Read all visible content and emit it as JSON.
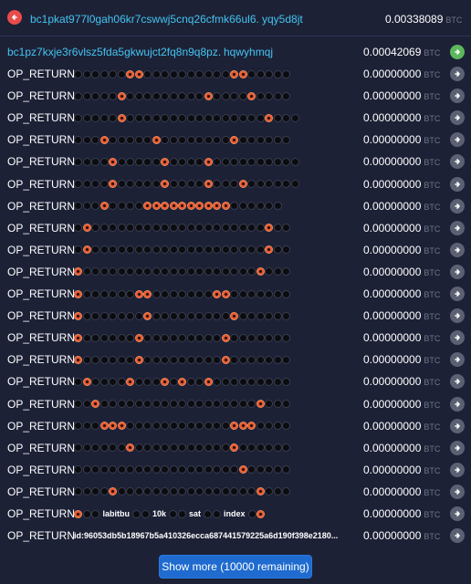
{
  "input": {
    "address_start": "bc1pkat977l0gah06kr7cswwj5cnq26cfmk66ul6...",
    "address_end": "yqy5d8jt",
    "amount": "0.00338089",
    "unit": "BTC"
  },
  "first_output": {
    "address_start": "bc1pz7kxje3r6vlsz5fda5gkwujct2fq8n9q8pz...",
    "address_end": "hqwyhmqj",
    "amount": "0.00042069",
    "unit": "BTC"
  },
  "op_return_label": "OP_RETURN",
  "zero_amount": "0.00000000",
  "unit": "BTC",
  "payload_rows": [
    "bbbbbbrrbbbbbbbbbbrrbbbbb",
    "bbbbbrbbbbbbbbbrbbbbrbbbb",
    "bbbbbrbbbbbbbbbbbbbbbbrbbb",
    "bbbrbbbbbrbbbbbbbbrbbbbbb",
    "bbbbrbbbbbrbbbbrbbbbbbbbbb",
    "bbbbrbbbbbrbbbbrbbbrbbbbbb",
    "bbbrbbbbrrrrrrrrrrbbbbbb",
    "brbbbbbbbbbbbbbbbbbbbbrbb",
    "brbbbbbbbbbbbbbbbbbbbbrbb",
    "rbbbbbbbbbbbbbbbbbbbbrbbb",
    "rbbbbbbrrbbbbbbbrrbbbbbbb",
    "rbbbbbbbrbbbbbbbbbrbbbbbb",
    "rbbbbbbrbbbbbbbbbrbbbbbbb",
    "rbbbbbbrbbbbbbbbbrbbbbbbb",
    "brbbbbrbbbrbrbbrbbbbbbbbb",
    "bbrbbbbbbbbbbbbbbbbbbrbbb",
    "bbbrrrbbbbbbbbbbbbrrrbbbb",
    "bbbbbbrbbbbbbbbbbbrbbbbbb",
    "bbbbbbbbbbbbbbbbbbbrbbbbb",
    "bbbbrbbbbbbbbbbbbbbbbrbbb"
  ],
  "special_row": {
    "segments": [
      "labitbu",
      "10k",
      "sat",
      "index"
    ]
  },
  "last_row": {
    "payload": "id:96053db5b18967b5a410326ecca687441579225a6d190f398e2180..."
  },
  "show_more_label": "Show more (10000 remaining)"
}
